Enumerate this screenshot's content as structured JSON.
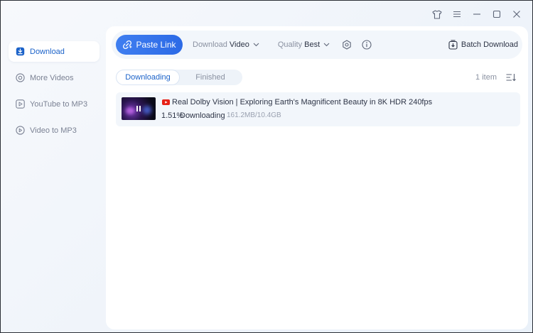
{
  "window": {
    "controls": [
      "shirt-icon",
      "menu-icon",
      "minimize-icon",
      "maximize-icon",
      "close-icon"
    ]
  },
  "sidebar": {
    "items": [
      {
        "label": "Download",
        "icon": "download-icon",
        "active": true
      },
      {
        "label": "More Videos",
        "icon": "play-circle-icon",
        "active": false
      },
      {
        "label": "YouTube to MP3",
        "icon": "youtube-mp3-icon",
        "active": false
      },
      {
        "label": "Video to MP3",
        "icon": "video-mp3-icon",
        "active": false
      }
    ]
  },
  "toolbar": {
    "paste_label": "Paste Link",
    "download_label": "Download",
    "download_value": "Video",
    "quality_label": "Quality",
    "quality_value": "Best",
    "batch_label": "Batch Download"
  },
  "tabs": [
    {
      "label": "Downloading",
      "active": true
    },
    {
      "label": "Finished",
      "active": false
    }
  ],
  "list": {
    "count": "1 item",
    "items": [
      {
        "source": "youtube-icon",
        "title": "Real Dolby Vision | Exploring Earth's Magnificent Beauty in 8K HDR 240fps",
        "progress": "1.51%",
        "status": "Downloading",
        "size": "161.2MB/10.4GB"
      }
    ]
  },
  "colors": {
    "accent": "#2c6ae6",
    "active_text": "#1c63c9",
    "youtube": "#e62117"
  }
}
